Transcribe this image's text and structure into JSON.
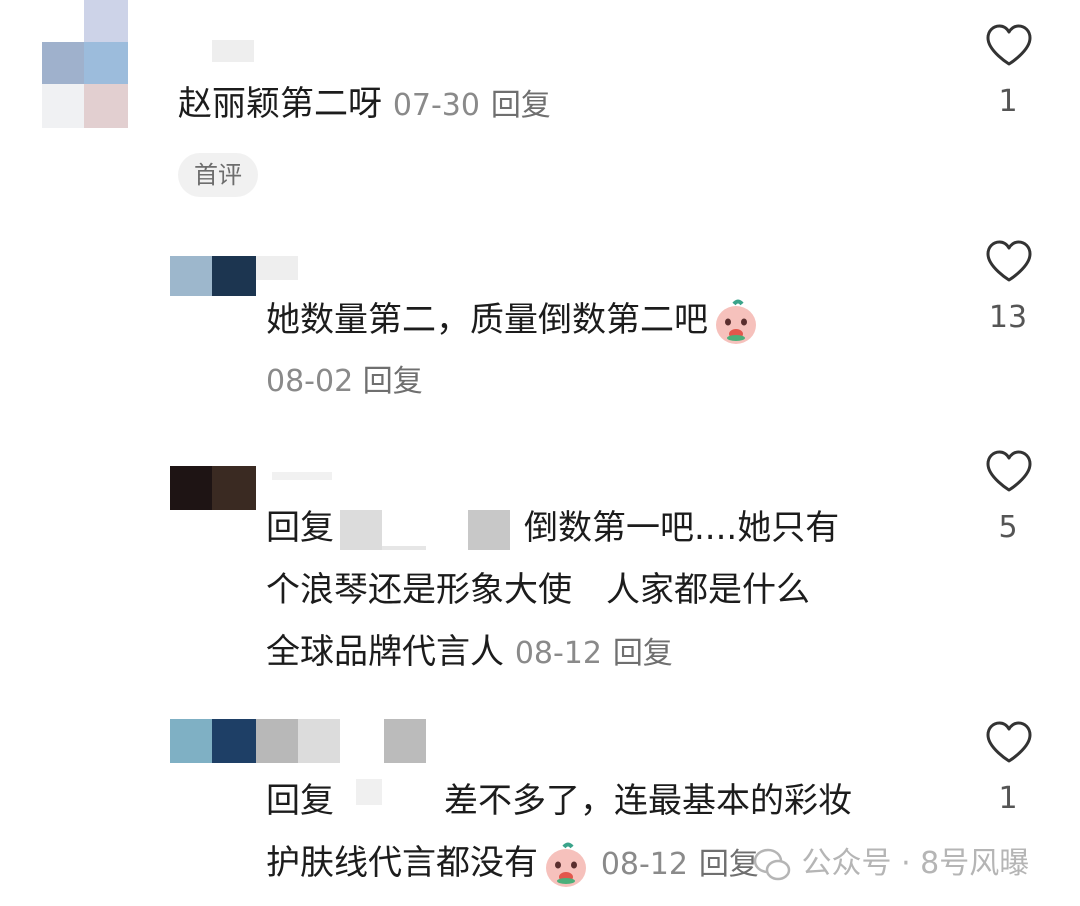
{
  "comments": [
    {
      "text": "赵丽颖第二呀",
      "date": "07-30",
      "reply_label": "回复",
      "badge": "首评",
      "likes": "1"
    },
    {
      "text": "她数量第二，质量倒数第二吧",
      "emoji": "pig-emoji",
      "date": "08-02",
      "reply_label": "回复",
      "likes": "13"
    },
    {
      "line1_prefix": "回复",
      "line1_suffix": "倒数第一吧....她只有",
      "line2": "个浪琴还是形象大使　人家都是什么",
      "line3": "全球品牌代言人",
      "date": "08-12",
      "reply_label": "回复",
      "likes": "5"
    },
    {
      "line1_prefix": "回复",
      "line1_suffix": "差不多了，连最基本的彩妆",
      "line2": "护肤线代言都没有",
      "emoji": "pig-emoji",
      "date": "08-12",
      "reply_label": "回复",
      "likes": "1"
    }
  ],
  "watermark": {
    "text": "公众号 · 8号风曝",
    "icon": "wechat-icon"
  },
  "colors": {
    "text": "#1c1c1c",
    "meta": "#8a8a8a",
    "badge_bg": "#f1f1f1",
    "heart": "#333333"
  }
}
